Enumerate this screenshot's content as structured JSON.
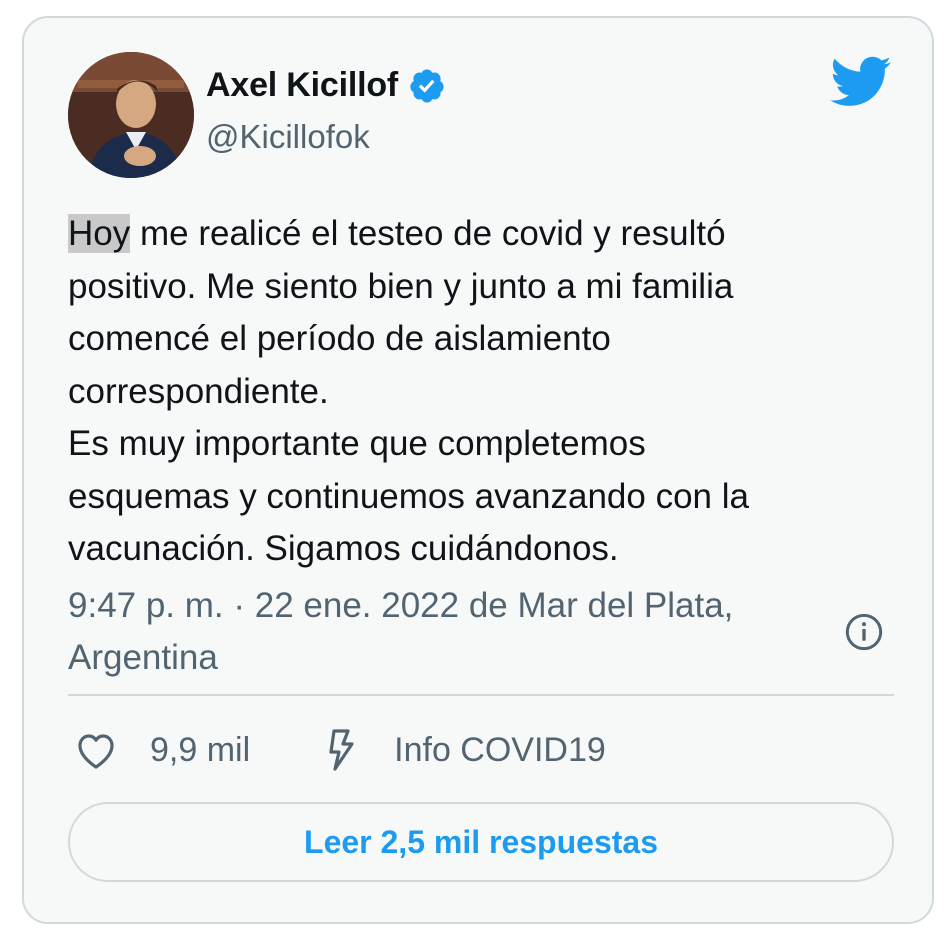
{
  "author": {
    "name": "Axel Kicillof",
    "handle": "@Kicillofok",
    "verified": true
  },
  "tweet": {
    "highlighted_word": "Hoy",
    "text_rest": " me realicé el testeo de covid y resultó\npositivo. Me siento bien y junto a mi familia\ncomencé el período de aislamiento\ncorrespondiente.\nEs muy importante que completemos\nesquemas y continuemos avanzando con la\nvacunación. Sigamos cuidándonos.",
    "timestamp": "9:47 p. m. · 22 ene. 2022 de Mar del Plata,\nArgentina"
  },
  "actions": {
    "likes": "9,9 mil",
    "info_label": "Info COVID19"
  },
  "replies_button": "Leer 2,5 mil respuestas",
  "icons": {
    "brand": "twitter-bird-icon",
    "verified": "verified-badge-icon",
    "info": "info-icon",
    "like": "heart-icon",
    "covid": "lightning-icon"
  },
  "colors": {
    "brand": "#1d9bf0",
    "text": "#0f1419",
    "secondary": "#536471",
    "border": "#cfd9de",
    "card_bg": "#f7f9f9"
  }
}
